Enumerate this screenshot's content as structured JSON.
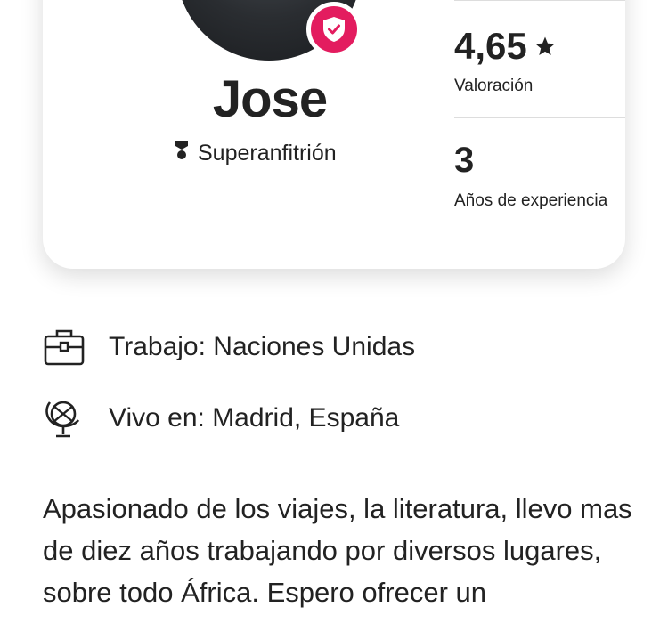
{
  "host": {
    "name": "Jose",
    "superhost_label": "Superanfitrión",
    "badge_color": "#e31c5f"
  },
  "stats": {
    "rating": "4,65",
    "rating_label": "Valoración",
    "years": "3",
    "years_label": "Años de experiencia"
  },
  "details": {
    "work": "Trabajo: Naciones Unidas",
    "work_icon": "briefcase-icon",
    "location": "Vivo en: Madrid, España",
    "location_icon": "globe-icon"
  },
  "bio": "Apasionado de los viajes, la literatura, llevo mas de diez años trabajando por diversos lugares, sobre todo África. Espero ofrecer un"
}
